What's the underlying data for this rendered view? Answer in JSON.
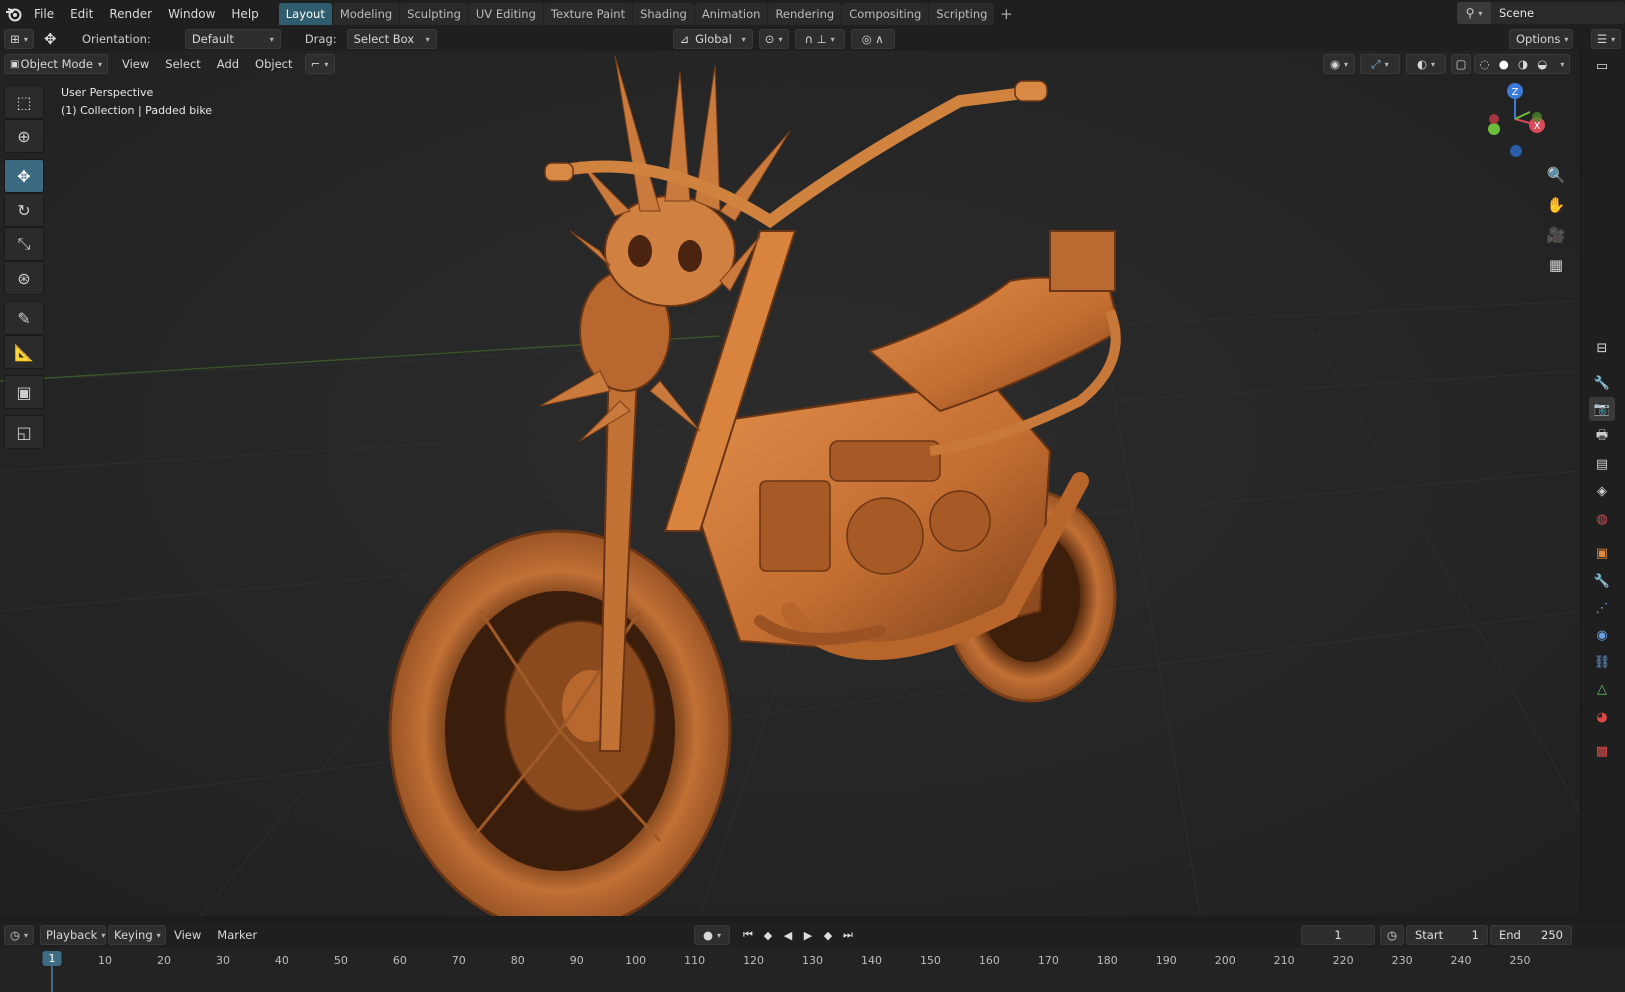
{
  "topbar": {
    "menus": [
      "File",
      "Edit",
      "Render",
      "Window",
      "Help"
    ],
    "workspaces": [
      "Layout",
      "Modeling",
      "Sculpting",
      "UV Editing",
      "Texture Paint",
      "Shading",
      "Animation",
      "Rendering",
      "Compositing",
      "Scripting"
    ],
    "active_workspace": "Layout",
    "add_label": "+",
    "scene_name": "Scene"
  },
  "toolheader": {
    "orientation_label": "Orientation:",
    "orientation_value": "Default",
    "drag_label": "Drag:",
    "drag_value": "Select Box",
    "transform_orientation": "Global",
    "options_label": "Options"
  },
  "viewport": {
    "mode": "Object Mode",
    "menus": [
      "View",
      "Select",
      "Add",
      "Object"
    ],
    "perspective_label": "User Perspective",
    "collection_label": "(1) Collection | Padded bike",
    "axes": {
      "z": "Z",
      "x": "X"
    },
    "colors": {
      "model": "#c8773a",
      "background": "#292929",
      "accent": "#3c6a80"
    }
  },
  "tools": [
    "select-box",
    "cursor",
    "move",
    "rotate",
    "scale",
    "transform",
    "annotate",
    "measure",
    "add-cube",
    "extrude"
  ],
  "timeline": {
    "menus": [
      "Playback",
      "Keying",
      "View",
      "Marker"
    ],
    "current_frame": "1",
    "start_label": "Start",
    "start_value": "1",
    "end_label": "End",
    "end_value": "250",
    "ruler": [
      "1",
      "10",
      "20",
      "30",
      "40",
      "50",
      "60",
      "70",
      "80",
      "90",
      "100",
      "110",
      "120",
      "130",
      "140",
      "150",
      "160",
      "170",
      "180",
      "190",
      "200",
      "210",
      "220",
      "230",
      "240",
      "250"
    ]
  }
}
